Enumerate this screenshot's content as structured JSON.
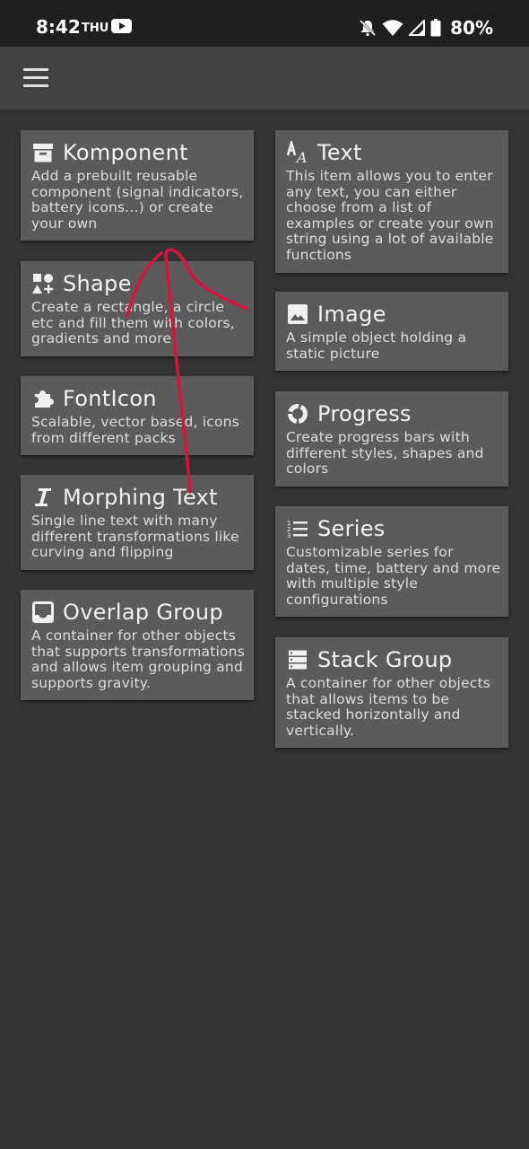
{
  "status_bar": {
    "time": "8:42",
    "day": "THU",
    "battery": "80%",
    "icons": [
      "youtube-icon",
      "dnd-off-icon",
      "wifi-icon",
      "signal-icon",
      "battery-icon"
    ]
  },
  "app_bar": {
    "menu_icon": "hamburger-menu-icon"
  },
  "left_cards": [
    {
      "title": "Komponent",
      "description": "Add a prebuilt reusable component (signal indicators, battery icons...) or create your own",
      "icon": "archive-box-icon"
    },
    {
      "title": "Shape",
      "description": "Create a rectangle, a circle etc and fill them with colors, gradients and more",
      "icon": "shapes-icon"
    },
    {
      "title": "FontIcon",
      "description": "Scalable, vector based, icons from different packs",
      "icon": "puzzle-icon"
    },
    {
      "title": "Morphing Text",
      "description": "Single line text with many different transformations like curving and flipping",
      "icon": "italic-i-icon"
    },
    {
      "title": "Overlap Group",
      "description": "A container for other objects that supports transformations and allows item grouping and supports gravity.",
      "icon": "inbox-tray-icon"
    }
  ],
  "right_cards": [
    {
      "title": "Text",
      "description": "This item allows you to enter any text, you can either choose from a list of examples or create your own string using a lot of available functions",
      "icon": "font-aa-icon"
    },
    {
      "title": "Image",
      "description": "A simple object holding a static picture",
      "icon": "image-icon"
    },
    {
      "title": "Progress",
      "description": "Create progress bars with different styles, shapes and colors",
      "icon": "donut-progress-icon"
    },
    {
      "title": "Series",
      "description": "Customizable series for dates, time, battery and more with multiple style configurations",
      "icon": "numbered-list-icon"
    },
    {
      "title": "Stack Group",
      "description": "A container for other objects that allows items to be stacked horizontally and vertically.",
      "icon": "stacked-rows-icon"
    }
  ],
  "colors": {
    "background": "#333333",
    "app_bar": "#424242",
    "status_bar": "#1f1f1f",
    "card": "#5b5b5b",
    "annotation_stroke": "#d9143c"
  }
}
